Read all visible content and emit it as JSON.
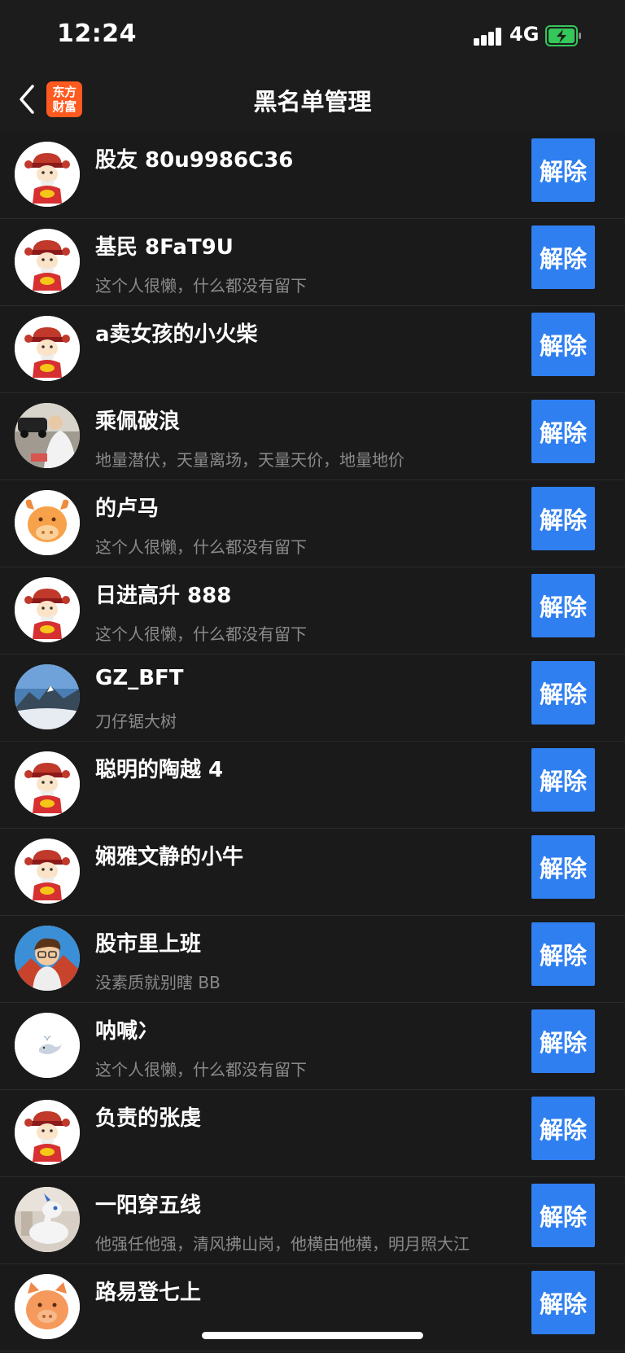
{
  "status": {
    "time": "12:24",
    "network": "4G",
    "signal_icon": "signal-bars-icon",
    "battery_icon": "battery-charging-icon",
    "battery_color": "#34c759"
  },
  "nav": {
    "title": "黑名单管理",
    "back_icon": "chevron-left-icon",
    "logo_text_line1": "东方",
    "logo_text_line2": "财富",
    "logo_color": "#ff5a1f"
  },
  "colors": {
    "background": "#1a1a1a",
    "button": "#2f7ff0",
    "secondary_text": "#8a8a8a"
  },
  "users": [
    {
      "name": "股友 80u9986C36",
      "signature": "",
      "avatar": "fortune-god"
    },
    {
      "name": "基民 8FaT9U",
      "signature": "这个人很懒，什么都没有留下",
      "avatar": "fortune-god"
    },
    {
      "name": "a卖女孩的小火柴",
      "signature": "",
      "avatar": "fortune-god"
    },
    {
      "name": "乘佩破浪",
      "signature": "地量潜伏，天量离场，天量天价，地量地价",
      "avatar": "photo-car"
    },
    {
      "name": "的卢马",
      "signature": "这个人很懒，什么都没有留下",
      "avatar": "orange-bull"
    },
    {
      "name": "日进高升 888",
      "signature": "这个人很懒，什么都没有留下",
      "avatar": "fortune-god"
    },
    {
      "name": "GZ_BFT",
      "signature": "刀仔锯大树",
      "avatar": "mountain"
    },
    {
      "name": "聪明的陶越 4",
      "signature": "",
      "avatar": "fortune-god"
    },
    {
      "name": "娴雅文静的小牛",
      "signature": "",
      "avatar": "fortune-god"
    },
    {
      "name": "股市里上班",
      "signature": "没素质就别瞎 BB",
      "avatar": "cartoon-boy"
    },
    {
      "name": "呐喊冫",
      "signature": "这个人很懒，什么都没有留下",
      "avatar": "whale"
    },
    {
      "name": "负责的张虔",
      "signature": "",
      "avatar": "fortune-god"
    },
    {
      "name": "一阳穿五线",
      "signature": "他强任他强，清风拂山岗，他横由他横，明月照大江",
      "avatar": "dragon"
    },
    {
      "name": "路易登七上",
      "signature": "",
      "avatar": "orange-pig"
    }
  ],
  "unblock_label": "解除"
}
